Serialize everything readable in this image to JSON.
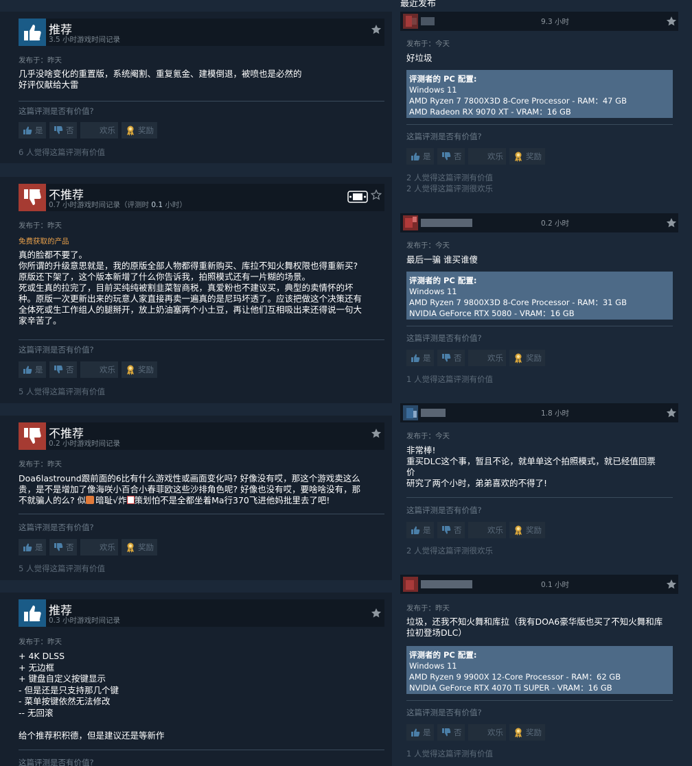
{
  "left_reviews": [
    {
      "verdict": "推荐",
      "recommended": true,
      "hours": "3.5 小时游戏时间记录",
      "posted": "发布于：昨天",
      "body": "几乎没啥变化的重置版，系统阉割、重复氪金、建模倒退，被喷也是必然的\n好评仅献给大雷",
      "helpful_q": "这篇评测是否有价值?",
      "votes": {
        "yes": "是",
        "no": "否",
        "funny": "欢乐",
        "award": "奖励"
      },
      "count": "6 人觉得这篇评测有价值"
    },
    {
      "verdict": "不推荐",
      "recommended": false,
      "hours_prefix": "0.7 小时游戏时间记录（评测时 ",
      "hours_bold": "0.1",
      "hours_suffix": " 小时）",
      "posted": "发布于：昨天",
      "free_tag": "免费获取的产品",
      "body": "真的脸都不要了。\n你所谓的升级意思就是，我的原版全部人物都得重新购买、库拉不知火舞权限也得重新买?\n原版还下架了，这个版本新增了什么你告诉我，拍照模式还有一片糊的场景。\n死或生真的拉完了，目前买纯纯被割韭菜智商税，真爱粉也不建议买，典型的卖情怀的坏\n种。原版一次更新出来的玩意人家直接再卖一遍真的是尼玛坏透了。应该把做这个决策还有\n全体死或生工作组人的腿掰开，放上奶油塞两个小土豆，再让他们互相吸出来还得说一句大\n家辛苦了。",
      "helpful_q": "这篇评测是否有价值?",
      "votes": {
        "yes": "是",
        "no": "否",
        "funny": "欢乐",
        "award": "奖励"
      },
      "count": "5 人觉得这篇评测有价值"
    },
    {
      "verdict": "不推荐",
      "recommended": false,
      "hours": "0.2 小时游戏时间记录",
      "posted": "发布于：昨天",
      "body_line1": "Doa6lastround跟前面的6比有什么游戏性或画面变化吗? 好像没有哎，那这个游戏卖这么",
      "body_line2": "贵，是不是增加了像海咲小百合小春菲欧这些沙排角色呢? 好像也没有哎，要啥啥没有，那",
      "body_line3_a": "不就骗人的么? 似",
      "body_line3_b": "暗耻√炸",
      "body_line3_c": "策划怕不是全都坐着Ma行370飞进他妈批里去了吧!",
      "helpful_q": "这篇评测是否有价值?",
      "votes": {
        "yes": "是",
        "no": "否",
        "funny": "欢乐",
        "award": "奖励"
      },
      "count": "5 人觉得这篇评测有价值"
    },
    {
      "verdict": "推荐",
      "recommended": true,
      "hours": "0.3 小时游戏时间记录",
      "posted": "发布于：昨天",
      "body": "+ 4K DLSS\n+ 无边框\n+ 键盘自定义按键显示\n- 但是还是只支持那几个键\n- 菜单按键依然无法修改\n-- 无回滚\n\n给个推荐积积德，但是建议还是等新作",
      "helpful_q": "这篇评测是否有价值?"
    }
  ],
  "right_title": "最近发布",
  "right_reviews": [
    {
      "hours": "9.3 小时",
      "posted": "发布于：今天",
      "body": "好垃圾",
      "pc_title": "评测者的 PC 配置:",
      "pc": [
        "Windows 11",
        "AMD Ryzen 7 7800X3D 8-Core Processor - RAM：47 GB",
        "AMD Radeon RX 9070 XT - VRAM：16 GB"
      ],
      "helpful_q": "这篇评测是否有价值?",
      "votes": {
        "yes": "是",
        "no": "否",
        "funny": "欢乐",
        "award": "奖励"
      },
      "count1": "2 人觉得这篇评测有价值",
      "count2": "2 人觉得这篇评测很欢乐",
      "avatar_color": "#a43a3a"
    },
    {
      "hours": "0.2 小时",
      "posted": "发布于：今天",
      "body": "最后一骗 谁买谁傻",
      "pc_title": "评测者的 PC 配置:",
      "pc": [
        "Windows 11",
        "AMD Ryzen 7 9800X3D 8-Core Processor - RAM：31 GB",
        "NVIDIA GeForce RTX 5080 - VRAM：16 GB"
      ],
      "helpful_q": "这篇评测是否有价值?",
      "votes": {
        "yes": "是",
        "no": "否",
        "funny": "欢乐",
        "award": "奖励"
      },
      "count1": "1 人觉得这篇评测有价值",
      "avatar_color": "#b03a3a"
    },
    {
      "hours": "1.8 小时",
      "posted": "发布于：今天",
      "body": "非常棒!\n重买DLC这个事，暂且不论，就单单这个拍照模式，就已经值回票\n价\n研究了两个小时，弟弟喜欢的不得了!",
      "helpful_q": "这篇评测是否有价值?",
      "votes": {
        "yes": "是",
        "no": "否",
        "funny": "欢乐",
        "award": "奖励"
      },
      "count1": "2 人觉得这篇评测很欢乐",
      "avatar_color": "#3a6b9a"
    },
    {
      "hours": "0.1 小时",
      "posted": "发布于：昨天",
      "body": "垃圾，还我不知火舞和库拉（我有DOA6豪华版也买了不知火舞和库\n拉初登场DLC）",
      "pc_title": "评测者的 PC 配置:",
      "pc": [
        "Windows 11",
        "AMD Ryzen 9 9900X 12-Core Processor - RAM：62 GB",
        "NVIDIA GeForce RTX 4070 Ti SUPER - VRAM：16 GB"
      ],
      "helpful_q": "这篇评测是否有价值?",
      "votes": {
        "yes": "是",
        "no": "否",
        "funny": "欢乐",
        "award": "奖励"
      },
      "count1": "1 人觉得这篇评测有价值",
      "avatar_color": "#a83a3a"
    }
  ],
  "colors": {
    "bg": "#1b2838",
    "card": "#16202d",
    "header": "#101822",
    "thumb_up": "#1a5b87",
    "thumb_down": "#a63b32",
    "pc_box": "#4d6a87",
    "free_tag": "#e9a04a"
  },
  "icons": [
    "thumbs-up-icon",
    "thumbs-down-icon",
    "star-icon",
    "award-icon",
    "steam-deck-icon"
  ]
}
